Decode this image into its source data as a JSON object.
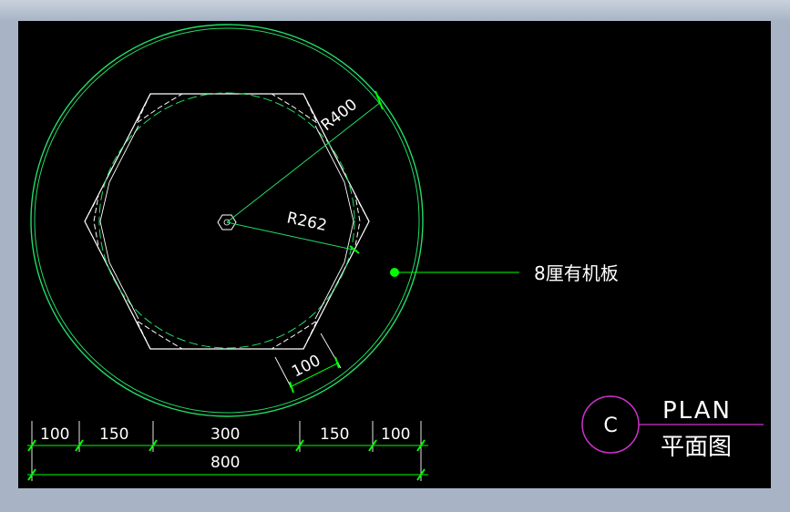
{
  "drawing": {
    "radius_outer_label": "R400",
    "radius_inner_label": "R262",
    "offset_label": "100",
    "material_label": "8厘有机板",
    "dimensions_segments": [
      "100",
      "150",
      "300",
      "150",
      "100"
    ],
    "dimension_total": "800"
  },
  "title_block": {
    "marker": "C",
    "title_en": "PLAN",
    "title_cn": "平面图"
  },
  "colors": {
    "background": "#000000",
    "line_white": "#ffffff",
    "circle_green": "#22dd66",
    "dim_green": "#00ff00",
    "title_magenta": "#cc33cc"
  }
}
